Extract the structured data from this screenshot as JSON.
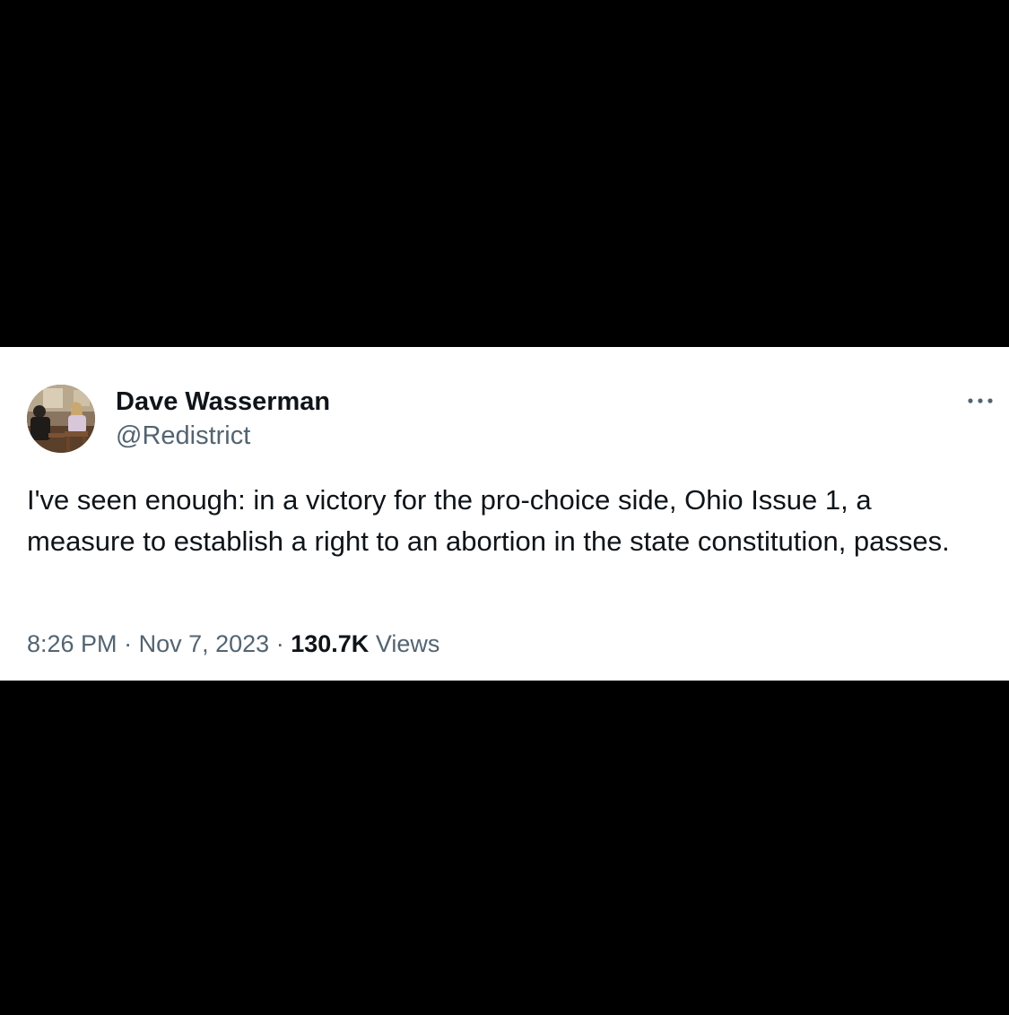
{
  "tweet": {
    "author": {
      "display_name": "Dave Wasserman",
      "handle": "@Redistrict",
      "avatar_icon": "profile-photo"
    },
    "more_icon": "more-horizontal-icon",
    "text": "I've seen enough: in a victory for the pro-choice side, Ohio Issue 1, a measure to establish a right to an abortion in the state constitution, passes.",
    "time": "8:26 PM",
    "separator": "·",
    "date": "Nov 7, 2023",
    "views_count": "130.7K",
    "views_label": "Views"
  },
  "colors": {
    "background": "#000000",
    "card": "#ffffff",
    "primary_text": "#0f1419",
    "secondary_text": "#536471"
  }
}
